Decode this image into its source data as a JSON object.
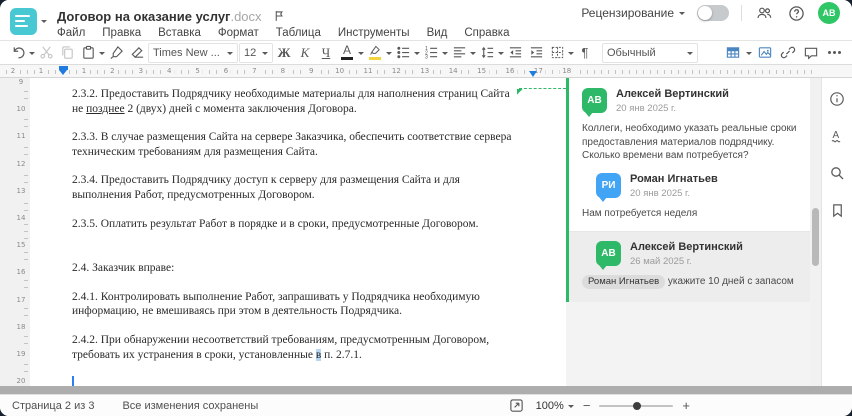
{
  "window": {
    "title": "Договор на оказание услуг",
    "title_ext": ".docx"
  },
  "header": {
    "menu": [
      "Файл",
      "Правка",
      "Вставка",
      "Формат",
      "Таблица",
      "Инструменты",
      "Вид",
      "Справка"
    ],
    "review_label": "Рецензирование",
    "avatar_initials": "АВ"
  },
  "toolbar": {
    "font_name": "Times New ...",
    "font_size": "12",
    "bold": "Ж",
    "italic": "К",
    "underline": "Ч",
    "font_color": "А",
    "paragraph_mark": "¶",
    "style_name": "Обычный"
  },
  "ruler": {
    "pre_numbers": [
      "2",
      "1"
    ],
    "main_numbers": [
      "1",
      "2",
      "3",
      "4",
      "5",
      "6",
      "7",
      "8",
      "9",
      "10",
      "11",
      "12",
      "13",
      "14",
      "15",
      "16",
      "17",
      "18"
    ],
    "v_numbers": [
      "9",
      "10",
      "11",
      "12",
      "13",
      "14",
      "15",
      "16",
      "17",
      "18",
      "19",
      "20"
    ]
  },
  "document": {
    "p1": {
      "a": "2.3.2. Предоставить Подрядчику необходимые материалы для наполнения страниц Сайта не ",
      "u": "позднее",
      "b": " 2 (двух) дней с момента заключения Договора."
    },
    "p2": "2.3.3. В случае размещения Сайта на сервере Заказчика, обеспечить соответствие сервера техническим требованиям для размещения Сайта.",
    "p3": "2.3.4. Предоставить Подрядчику доступ к серверу для размещения Сайта и для выполнения Работ, предусмотренных Договором.",
    "p4": "2.3.5. Оплатить результат Работ в порядке и в сроки, предусмотренные Договором.",
    "p5": "2.4. Заказчик вправе:",
    "p6": "2.4.1. Контролировать выполнение Работ, запрашивать у Подрядчика необходимую информацию, не вмешиваясь при этом в деятельность Подрядчика.",
    "p7": {
      "a": "2.4.2. При обнаружении несоответствий требованиям, предусмотренным Договором, требовать их устранения в сроки, установленные ",
      "h": "в",
      "b": " п. 2.7.1."
    }
  },
  "comments": [
    {
      "initials": "АВ",
      "name": "Алексей Вертинский",
      "date": "20 янв 2025 г.",
      "text": "Коллеги, необходимо указать реальные сроки предоставления материалов подрядчику. Сколько времени вам потребуется?"
    },
    {
      "initials": "РИ",
      "name": "Роман Игнатьев",
      "date": "20 янв 2025 г.",
      "text": "Нам потребуется неделя"
    },
    {
      "initials": "АВ",
      "name": "Алексей Вертинский",
      "date": "26 май 2025 г.",
      "mention": "Роман Игнатьев",
      "text": " укажите 10 дней с запасом"
    }
  ],
  "statusbar": {
    "page": "Страница 2 из 3",
    "saved": "Все изменения сохранены",
    "zoom": "100%"
  },
  "colors": {
    "teal": "#47c8d3",
    "green": "#2eb968",
    "avblue": "#42a4f5",
    "icblue": "#4a87c0",
    "sel": "#b9d6f3",
    "cursor": "#2d7ff0",
    "mkblue": "#1e7be0"
  }
}
